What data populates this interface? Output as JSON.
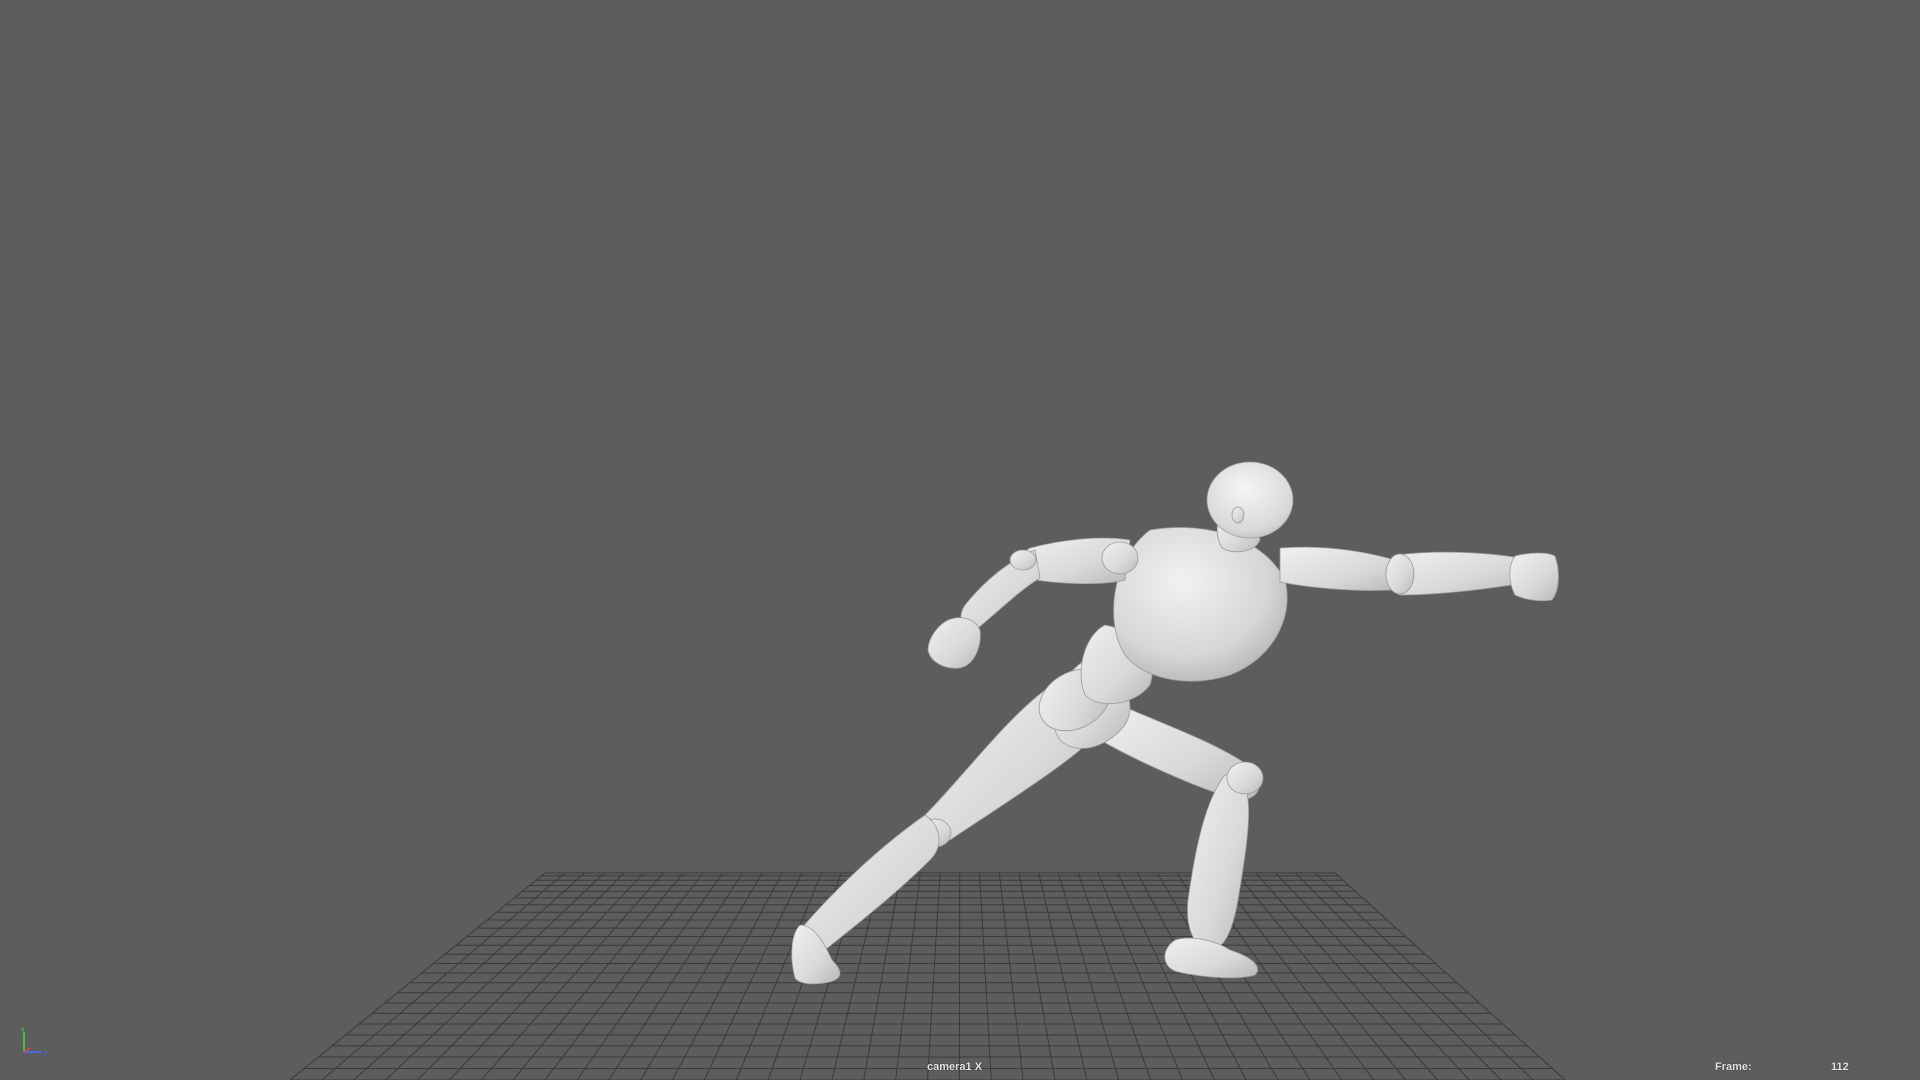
{
  "viewport": {
    "camera_name": "camera1 X",
    "frame_label": "Frame:",
    "frame_value": "112",
    "background_color": "#5d5d5d",
    "grid_color": "#3a3a3a",
    "model_color": "#e3e3e3",
    "model_shadow_color": "#a9a9a9"
  },
  "axis_gizmo": {
    "y_axis": "y",
    "x_axis": "x",
    "z_axis": "z",
    "y_color": "#3ddc3d",
    "x_color": "#e84040",
    "z_color": "#4a6cff"
  }
}
